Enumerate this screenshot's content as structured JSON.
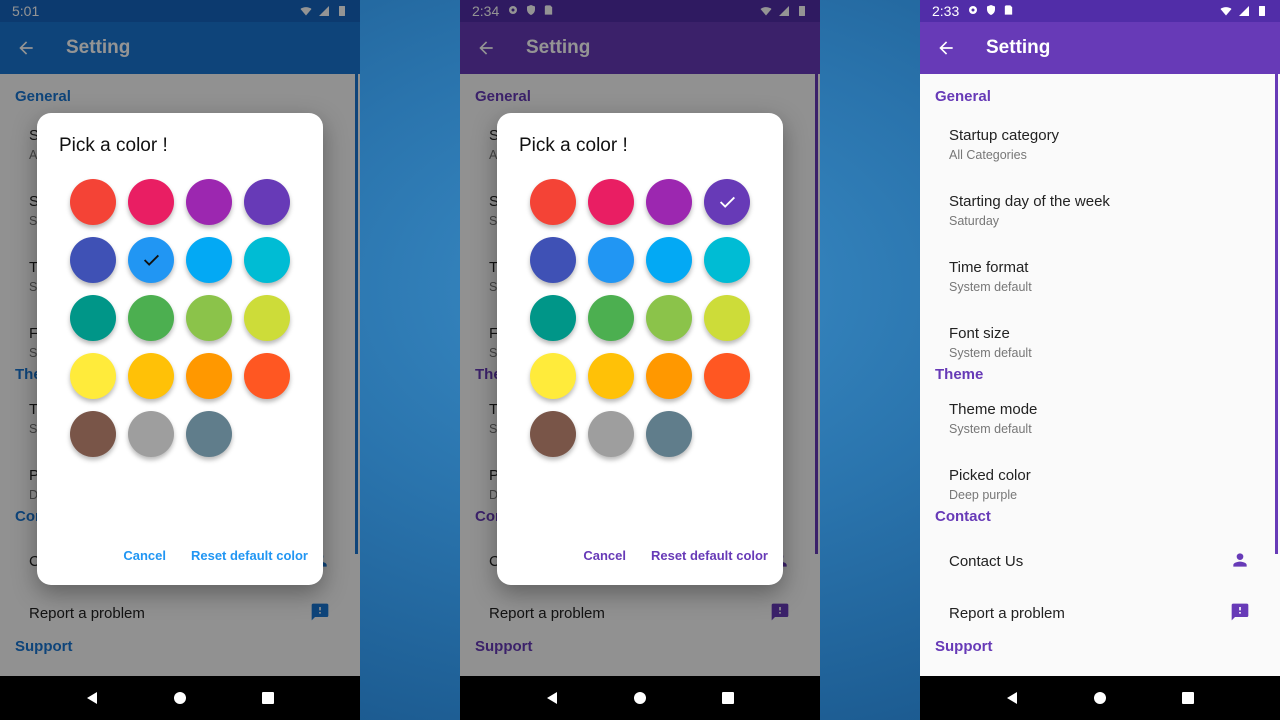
{
  "colors": {
    "blue_primary": "#1976d2",
    "blue_dark": "#1565c0",
    "blue_accent": "#2196f3",
    "purple_primary": "#673ab7",
    "purple_dark": "#512da8",
    "purple_accent": "#673ab7"
  },
  "screens": [
    {
      "status_time": "5:01",
      "app_title": "Setting",
      "has_dialog": true,
      "theme": "blue",
      "selected_color_index": 5
    },
    {
      "status_time": "2:34",
      "app_title": "Setting",
      "has_dialog": true,
      "theme": "purple",
      "selected_color_index": 3
    },
    {
      "status_time": "2:33",
      "app_title": "Setting",
      "has_dialog": false,
      "theme": "purple",
      "selected_color_index": null
    }
  ],
  "settings": {
    "general_header": "General",
    "startup_category": {
      "title": "Startup category",
      "subtitle": "All Categories"
    },
    "starting_day": {
      "title": "Starting day of the week",
      "subtitle": "Saturday"
    },
    "time_format": {
      "title": "Time format",
      "subtitle": "System default"
    },
    "font_size": {
      "title": "Font size",
      "subtitle": "System default"
    },
    "theme_header": "Theme",
    "theme_mode": {
      "title": "Theme mode",
      "subtitle": "System default"
    },
    "picked_color": {
      "title": "Picked color",
      "subtitle": "Deep purple"
    },
    "contact_header": "Contact",
    "contact_us": {
      "title": "Contact Us",
      "icon": "person-icon"
    },
    "report_problem": {
      "title": "Report a problem",
      "icon": "feedback-icon"
    },
    "support_header": "Support"
  },
  "dialog": {
    "title": "Pick a color !",
    "cancel_label": "Cancel",
    "reset_label": "Reset default color",
    "swatches": [
      "#f44336",
      "#e91e63",
      "#9c27b0",
      "#673ab7",
      "#3f51b5",
      "#2196f3",
      "#03a9f4",
      "#00bcd4",
      "#009688",
      "#4caf50",
      "#8bc34a",
      "#cddc39",
      "#ffeb3b",
      "#ffc107",
      "#ff9800",
      "#ff5722",
      "#795548",
      "#9e9e9e",
      "#607d8b"
    ]
  }
}
